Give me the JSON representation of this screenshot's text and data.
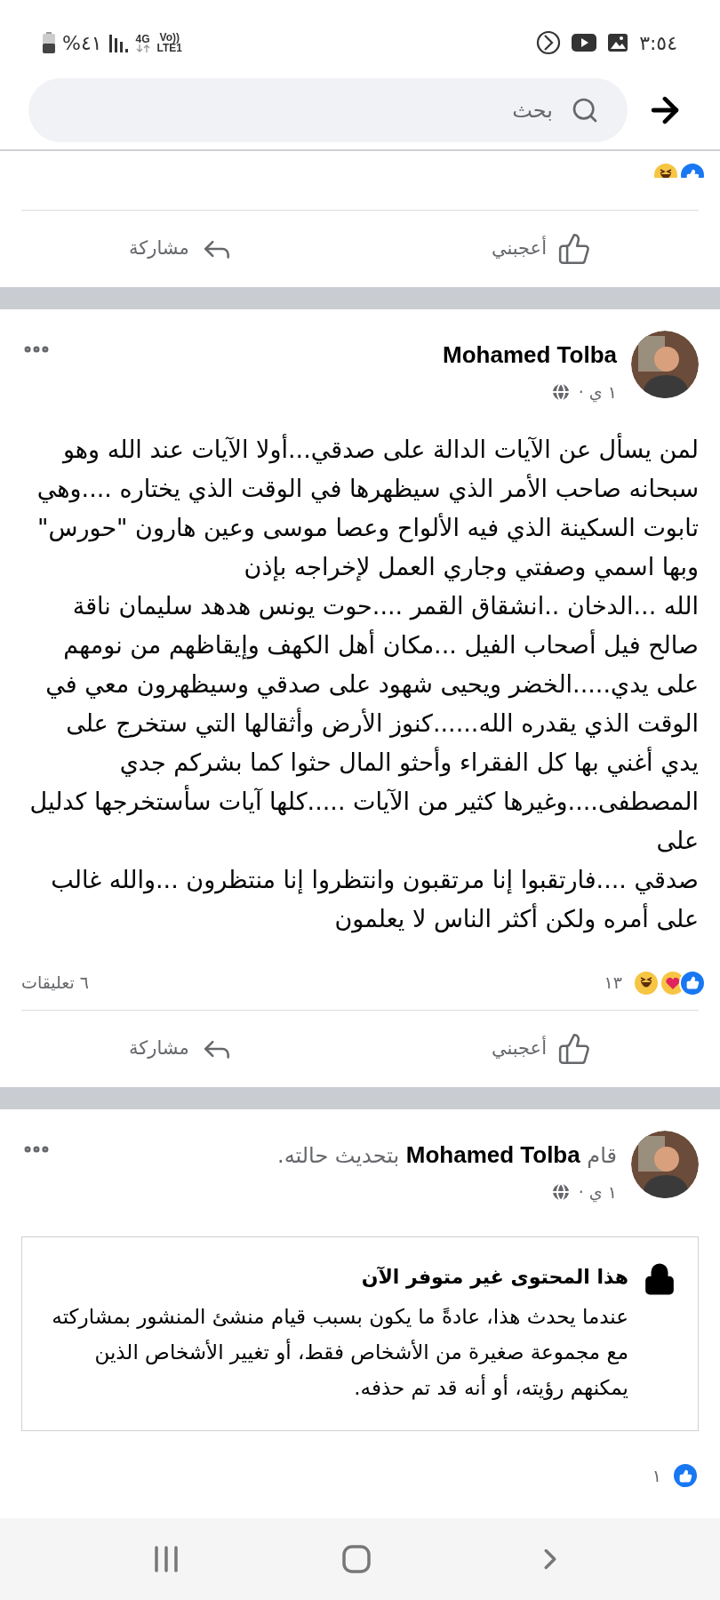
{
  "status_bar": {
    "time": "٣:٥٤",
    "battery": "%٤١",
    "network": "4G",
    "volte": "Vo))",
    "lte": "LTE1"
  },
  "search": {
    "placeholder": "بحث"
  },
  "top_post": {
    "reactions": [
      {
        "kind": "like"
      },
      {
        "kind": "haha"
      }
    ],
    "actions": [
      {
        "kind": "like",
        "label": "أعجبني"
      },
      {
        "kind": "share",
        "label": "مشاركة"
      }
    ]
  },
  "posts": [
    {
      "kind": "text",
      "author": "Mohamed Tolba",
      "time": "١ ي ·",
      "text": "لمن يسأل عن الآيات الدالة على صدقي...أولا الآيات عند الله وهو سبحانه صاحب الأمر الذي سيظهرها في الوقت الذي يختاره ....وهي تابوت السكينة الذي فيه الألواح وعصا موسى وعين هارون \"حورس\" وبها اسمي وصفتي وجاري العمل لإخراجه بإذن\nالله ...الدخان ..انشقاق القمر ....حوت يونس هدهد سليمان ناقة صالح فيل أصحاب الفيل ...مكان أهل الكهف وإيقاظهم من نومهم على يدي.....الخضر ويحيى شهود على صدقي وسيظهرون معي في الوقت الذي يقدره الله......كنوز الأرض وأثقالها التي ستخرج على يدي أغني بها كل الفقراء وأحثو المال حثوا كما بشركم جدي المصطفى....وغيرها كثير من الآيات .....كلها آيات سأستخرجها كدليل على\nصدقي ....فارتقبوا إنا مرتقبون وانتظروا إنا منتظرون ...والله غالب على أمره ولكن أكثر الناس لا يعلمون",
      "reactions": {
        "types": [
          {
            "kind": "like"
          },
          {
            "kind": "care"
          },
          {
            "kind": "haha"
          }
        ],
        "count": "١٣"
      },
      "comments": "٦ تعليقات",
      "actions": [
        {
          "kind": "like",
          "label": "أعجبني"
        },
        {
          "kind": "share",
          "label": "مشاركة"
        }
      ]
    },
    {
      "kind": "unavailable",
      "headline": "قام **Mohamed Tolba** بتحديث حالته.",
      "time": "١ ي ·",
      "notice": {
        "title": "هذا المحتوى غير متوفر الآن",
        "body": "عندما يحدث هذا، عادةً ما يكون بسبب قيام منشئ المنشور بمشاركته مع مجموعة صغيرة من الأشخاص فقط، أو تغيير الأشخاص الذين يمكنهم رؤيته، أو أنه قد تم حذفه."
      },
      "reactions": {
        "types": [
          {
            "kind": "like"
          }
        ],
        "count": "١"
      }
    }
  ]
}
